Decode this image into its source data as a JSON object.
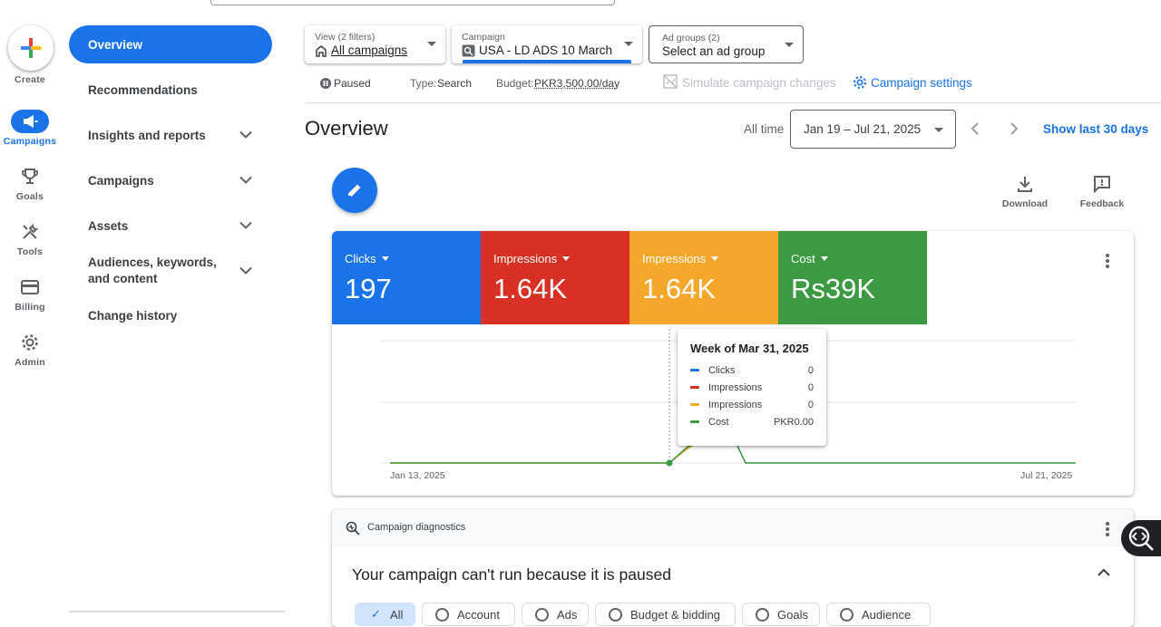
{
  "rail": {
    "create": "Create",
    "items": [
      {
        "label": "Campaigns",
        "icon": "megaphone-icon"
      },
      {
        "label": "Goals",
        "icon": "trophy-icon"
      },
      {
        "label": "Tools",
        "icon": "tools-icon"
      },
      {
        "label": "Billing",
        "icon": "credit-card-icon"
      },
      {
        "label": "Admin",
        "icon": "gear-icon"
      }
    ]
  },
  "nav": {
    "items": [
      {
        "label": "Overview"
      },
      {
        "label": "Recommendations"
      },
      {
        "label": "Insights and reports"
      },
      {
        "label": "Campaigns"
      },
      {
        "label": "Assets"
      },
      {
        "label": "Audiences, keywords, and content"
      },
      {
        "label": "Change history"
      }
    ]
  },
  "filters": {
    "view_small": "View (2 filters)",
    "view_main": "All campaigns",
    "campaign_small": "Campaign",
    "campaign_main": "USA - LD ADS 10 March",
    "adgroup_small": "Ad groups (2)",
    "adgroup_main": "Select an ad group"
  },
  "status": {
    "state": "Paused",
    "type_label": "Type:",
    "type_value": "Search",
    "budget_label": "Budget:",
    "budget_value": "PKR3,500.00/day",
    "simulate": "Simulate campaign changes",
    "settings": "Campaign settings"
  },
  "overview": {
    "title": "Overview",
    "all_time": "All time",
    "date_range": "Jan 19 – Jul 21, 2025",
    "show_last": "Show last 30 days",
    "download": "Download",
    "feedback": "Feedback"
  },
  "metrics": [
    {
      "label": "Clicks",
      "value": "197",
      "color": "#1a73e8"
    },
    {
      "label": "Impressions",
      "value": "1.64K",
      "color": "#d93025"
    },
    {
      "label": "Impressions",
      "value": "1.64K",
      "color": "#f4a72a"
    },
    {
      "label": "Cost",
      "value": "Rs39K",
      "color": "#3c9a43"
    }
  ],
  "chart": {
    "x_start": "Jan 13, 2025",
    "x_end": "Jul 21, 2025"
  },
  "tooltip": {
    "title": "Week of Mar 31, 2025",
    "rows": [
      {
        "name": "Clicks",
        "value": "0",
        "color": "#1a73e8"
      },
      {
        "name": "Impressions",
        "value": "0",
        "color": "#d93025"
      },
      {
        "name": "Impressions",
        "value": "0",
        "color": "#f4a72a"
      },
      {
        "name": "Cost",
        "value": "PKR0.00",
        "color": "#3c9a43"
      }
    ]
  },
  "diagnostics": {
    "header": "Campaign diagnostics",
    "message": "Your campaign can't run because it is paused",
    "chips": [
      "All",
      "Account",
      "Ads",
      "Budget & bidding",
      "Goals",
      "Audience"
    ]
  }
}
